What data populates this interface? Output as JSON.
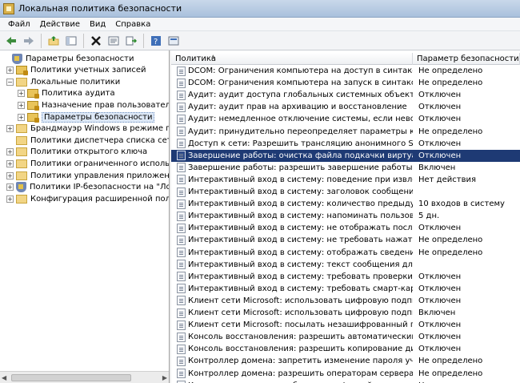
{
  "window": {
    "title": "Локальная политика безопасности"
  },
  "menu": [
    "Файл",
    "Действие",
    "Вид",
    "Справка"
  ],
  "toolbar_icons": [
    "back-icon",
    "forward-icon",
    "up-folder-icon",
    "show-hide-tree-icon",
    "delete-icon",
    "properties-icon",
    "export-icon",
    "help-icon",
    "console-icon"
  ],
  "tree": [
    {
      "label": "Параметры безопасности",
      "level": 0,
      "icon": "shield-icon",
      "expand": ""
    },
    {
      "label": "Политики учетных записей",
      "level": 1,
      "icon": "lock-folder-icon",
      "expand": "+"
    },
    {
      "label": "Локальные политики",
      "level": 1,
      "icon": "folder-icon",
      "expand": "−"
    },
    {
      "label": "Политика аудита",
      "level": 2,
      "icon": "lock-folder-icon",
      "expand": "+"
    },
    {
      "label": "Назначение прав пользователя",
      "level": 2,
      "icon": "lock-folder-icon",
      "expand": "+"
    },
    {
      "label": "Параметры безопасности",
      "level": 2,
      "icon": "lock-folder-icon",
      "expand": "+",
      "selected": true
    },
    {
      "label": "Брандмауэр Windows в режиме повыше",
      "level": 1,
      "icon": "folder-icon",
      "expand": "+"
    },
    {
      "label": "Политики диспетчера списка сетей",
      "level": 1,
      "icon": "folder-icon",
      "expand": ""
    },
    {
      "label": "Политики открытого ключа",
      "level": 1,
      "icon": "folder-icon",
      "expand": "+"
    },
    {
      "label": "Политики ограниченного использова",
      "level": 1,
      "icon": "folder-icon",
      "expand": "+"
    },
    {
      "label": "Политики управления приложениями",
      "level": 1,
      "icon": "folder-icon",
      "expand": "+"
    },
    {
      "label": "Политики IP-безопасности на \"Локаль",
      "level": 1,
      "icon": "shield-icon",
      "expand": "+"
    },
    {
      "label": "Конфигурация расширенной политики",
      "level": 1,
      "icon": "folder-icon",
      "expand": "+"
    }
  ],
  "columns": {
    "policy": "Политика",
    "setting": "Параметр безопасности"
  },
  "rows": [
    {
      "policy": "DCOM: Ограничения компьютера на доступ в синтаксисе SDD...",
      "setting": "Не определено"
    },
    {
      "policy": "DCOM: Ограничения компьютера на запуск в синтаксисе SDD...",
      "setting": "Не определено"
    },
    {
      "policy": "Аудит: аудит доступа глобальных системных объектов",
      "setting": "Отключен"
    },
    {
      "policy": "Аудит: аудит прав на архивацию и восстановление",
      "setting": "Отключен"
    },
    {
      "policy": "Аудит: немедленное отключение системы, если невозможно ...",
      "setting": "Отключен"
    },
    {
      "policy": "Аудит: принудительно переопределяет параметры категор...",
      "setting": "Не определено"
    },
    {
      "policy": "Доступ к сети: Разрешить трансляцию анонимного SID в имя",
      "setting": "Отключен"
    },
    {
      "policy": "Завершение работы: очистка файла подкачки виртуальной ...",
      "setting": "Отключен",
      "selected": true
    },
    {
      "policy": "Завершение работы: разрешить завершение работы систем...",
      "setting": "Включен"
    },
    {
      "policy": "Интерактивный вход в систему:  поведение при извлечении ...",
      "setting": "Нет действия"
    },
    {
      "policy": "Интерактивный вход в систему: заголовок сообщения для п...",
      "setting": ""
    },
    {
      "policy": "Интерактивный вход в систему: количество предыдущих под...",
      "setting": "10 входов в систему"
    },
    {
      "policy": "Интерактивный вход в систему: напоминать пользователям ...",
      "setting": "5 дн."
    },
    {
      "policy": "Интерактивный вход в систему: не отображать последнее и...",
      "setting": "Отключен"
    },
    {
      "policy": "Интерактивный вход в систему: не требовать нажатия CTRL...",
      "setting": "Не определено"
    },
    {
      "policy": "Интерактивный вход в систему: отображать сведения о поль...",
      "setting": "Не определено"
    },
    {
      "policy": "Интерактивный вход в систему: текст сообщения для польз...",
      "setting": ""
    },
    {
      "policy": "Интерактивный вход в систему: требовать проверки на конт...",
      "setting": "Отключен"
    },
    {
      "policy": "Интерактивный вход в систему: требовать смарт-карту",
      "setting": "Отключен"
    },
    {
      "policy": "Клиент сети Microsoft: использовать цифровую подпись (все...",
      "setting": "Отключен"
    },
    {
      "policy": "Клиент сети Microsoft: использовать цифровую подпись (с со...",
      "setting": "Включен"
    },
    {
      "policy": "Клиент сети Microsoft: посылать незашифрованный пароль с...",
      "setting": "Отключен"
    },
    {
      "policy": "Консоль восстановления: разрешить автоматический вход а...",
      "setting": "Отключен"
    },
    {
      "policy": "Консоль восстановления: разрешить копирование дискет и ...",
      "setting": "Отключен"
    },
    {
      "policy": "Контроллер домена: запретить изменение пароля учетных з...",
      "setting": "Не определено"
    },
    {
      "policy": "Контроллер домена: разрешить операторам сервера задава...",
      "setting": "Не определено"
    },
    {
      "policy": "Контроллер домена: требование цифровой подписи для LDA...",
      "setting": "Не определено"
    }
  ]
}
